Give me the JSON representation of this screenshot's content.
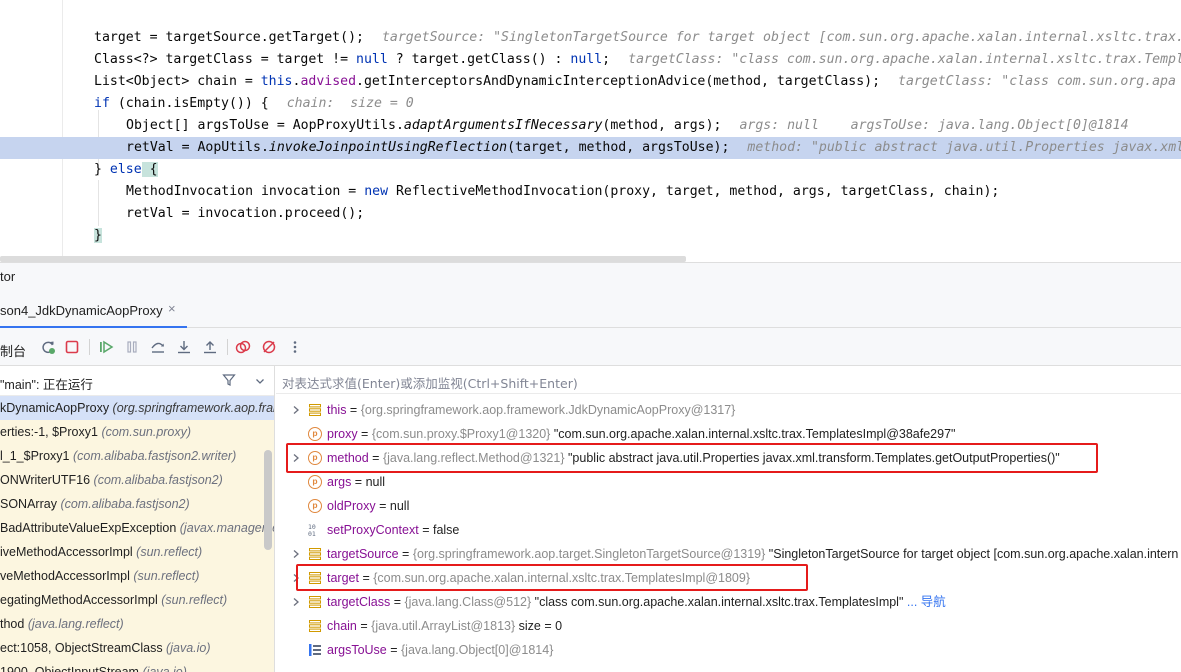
{
  "editor": {
    "lines": [
      {
        "parts": [
          {
            "t": "target = targetSource.getTarget();",
            "c": "plain"
          }
        ],
        "hint": "targetSource: \"SingletonTargetSource for target object [com.sun.org.apache.xalan.internal.xsltc.trax."
      },
      {
        "parts": [
          {
            "t": "Class<?> targetClass = target != ",
            "c": "plain"
          },
          {
            "t": "null",
            "c": "kw"
          },
          {
            "t": " ? target.getClass() : ",
            "c": "plain"
          },
          {
            "t": "null",
            "c": "kw"
          },
          {
            "t": ";",
            "c": "plain"
          }
        ],
        "hint": "targetClass: \"class com.sun.org.apache.xalan.internal.xsltc.trax.Templ"
      },
      {
        "parts": [
          {
            "t": "List<Object> chain = ",
            "c": "plain"
          },
          {
            "t": "this",
            "c": "kw"
          },
          {
            "t": ".",
            "c": "plain"
          },
          {
            "t": "advised",
            "c": "fld"
          },
          {
            "t": ".getInterceptorsAndDynamicInterceptionAdvice(method, targetClass);",
            "c": "plain"
          }
        ],
        "hint": "targetClass: \"class com.sun.org.apa"
      },
      {
        "parts": [
          {
            "t": "if",
            "c": "kw"
          },
          {
            "t": " (chain.isEmpty()) {",
            "c": "plain"
          }
        ],
        "hint": "chain:  size = 0"
      },
      {
        "parts": [
          {
            "t": "Object[] argsToUse = AopProxyUtils.",
            "c": "plain"
          },
          {
            "t": "adaptArgumentsIfNecessary",
            "c": "it"
          },
          {
            "t": "(method, args);",
            "c": "plain"
          }
        ],
        "hint": "args: null    argsToUse: java.lang.Object[0]@1814"
      },
      {
        "parts": [
          {
            "t": "retVal = AopUtils.",
            "c": "plain"
          },
          {
            "t": "invokeJoinpointUsingReflection",
            "c": "it"
          },
          {
            "t": "(target, method, argsToUse);",
            "c": "plain"
          }
        ],
        "hint": "method: \"public abstract java.util.Properties javax.xml"
      },
      {
        "parts": [
          {
            "t": "} ",
            "c": "plain"
          },
          {
            "t": "else",
            "c": "kw"
          },
          {
            "t": " {",
            "c": "plain"
          }
        ],
        "hint": ""
      },
      {
        "parts": [
          {
            "t": "MethodInvocation invocation = ",
            "c": "plain"
          },
          {
            "t": "new",
            "c": "kw"
          },
          {
            "t": " ReflectiveMethodInvocation(proxy, target, method, args, targetClass, chain);",
            "c": "plain"
          }
        ],
        "hint": ""
      },
      {
        "parts": [
          {
            "t": "retVal = invocation.proceed();",
            "c": "plain"
          }
        ],
        "hint": ""
      },
      {
        "parts": [
          {
            "t": "}",
            "c": "plain"
          }
        ],
        "hint": ""
      }
    ]
  },
  "panel": {
    "title": "tor",
    "session_tab": "son4_JdkDynamicAopProxy",
    "session_close": "×",
    "console_tab": "制台",
    "thread": "\"main\": 正在运行",
    "eval_placeholder": "对表达式求值(Enter)或添加监视(Ctrl+Shift+Enter)"
  },
  "toolbar_icons": [
    "rerun-icon",
    "stop-icon",
    "resume-icon",
    "pause-icon",
    "step-over-icon",
    "step-into-icon",
    "step-out-icon",
    "view-breakpoints-icon",
    "mute-breakpoints-icon",
    "more-icon"
  ],
  "frames": [
    {
      "name": "kDynamicAopProxy",
      "pkg": "(org.springframework.aop.framework)"
    },
    {
      "name": "erties:-1, $Proxy1",
      "pkg": "(com.sun.proxy)"
    },
    {
      "name": "l_1_$Proxy1",
      "pkg": "(com.alibaba.fastjson2.writer)"
    },
    {
      "name": "ONWriterUTF16",
      "pkg": "(com.alibaba.fastjson2)"
    },
    {
      "name": "SONArray",
      "pkg": "(com.alibaba.fastjson2)"
    },
    {
      "name": "BadAttributeValueExpException",
      "pkg": "(javax.management)"
    },
    {
      "name": "iveMethodAccessorImpl",
      "pkg": "(sun.reflect)"
    },
    {
      "name": "veMethodAccessorImpl",
      "pkg": "(sun.reflect)"
    },
    {
      "name": "egatingMethodAccessorImpl",
      "pkg": "(sun.reflect)"
    },
    {
      "name": "thod",
      "pkg": "(java.lang.reflect)"
    },
    {
      "name": "ect:1058, ObjectStreamClass",
      "pkg": "(java.io)"
    },
    {
      "name": "1900, ObjectInputStream",
      "pkg": "(java.io)"
    }
  ],
  "variables": [
    {
      "name": "this",
      "ref": "{org.springframework.aop.framework.JdkDynamicAopProxy@1317}",
      "value": "",
      "icon": "field",
      "expand": true
    },
    {
      "name": "proxy",
      "ref": "{com.sun.proxy.$Proxy1@1320}",
      "value": "\"com.sun.org.apache.xalan.internal.xsltc.trax.TemplatesImpl@38afe297\"",
      "icon": "param",
      "expand": false
    },
    {
      "name": "method",
      "ref": "{java.lang.reflect.Method@1321}",
      "value": "\"public abstract java.util.Properties javax.xml.transform.Templates.getOutputProperties()\"",
      "icon": "param",
      "expand": true
    },
    {
      "name": "args",
      "ref": "",
      "value": "null",
      "icon": "param",
      "expand": false
    },
    {
      "name": "oldProxy",
      "ref": "",
      "value": "null",
      "icon": "param",
      "expand": false
    },
    {
      "name": "setProxyContext",
      "ref": "",
      "value": "false",
      "icon": "bool",
      "expand": false
    },
    {
      "name": "targetSource",
      "ref": "{org.springframework.aop.target.SingletonTargetSource@1319}",
      "value": "\"SingletonTargetSource for target object [com.sun.org.apache.xalan.intern",
      "icon": "field",
      "expand": true
    },
    {
      "name": "target",
      "ref": "{com.sun.org.apache.xalan.internal.xsltc.trax.TemplatesImpl@1809}",
      "value": "",
      "icon": "field",
      "expand": true
    },
    {
      "name": "targetClass",
      "ref": "{java.lang.Class@512}",
      "value": "\"class com.sun.org.apache.xalan.internal.xsltc.trax.TemplatesImpl\"",
      "link": "... 导航",
      "icon": "field",
      "expand": true
    },
    {
      "name": "chain",
      "ref": "{java.util.ArrayList@1813}",
      "value": " size = 0",
      "icon": "field",
      "expand": false
    },
    {
      "name": "argsToUse",
      "ref": "{java.lang.Object[0]@1814}",
      "value": "",
      "icon": "array",
      "expand": false
    }
  ]
}
